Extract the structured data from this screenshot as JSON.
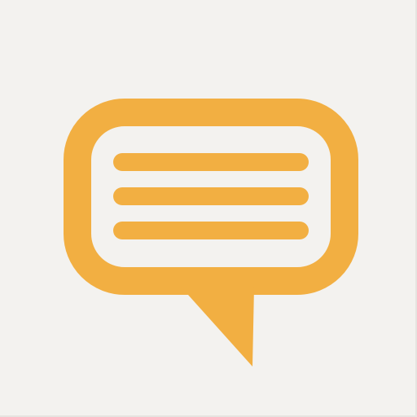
{
  "icon": {
    "name": "chat-bubble-icon",
    "color": "#F2AF42",
    "background": "#F3F2EF"
  }
}
